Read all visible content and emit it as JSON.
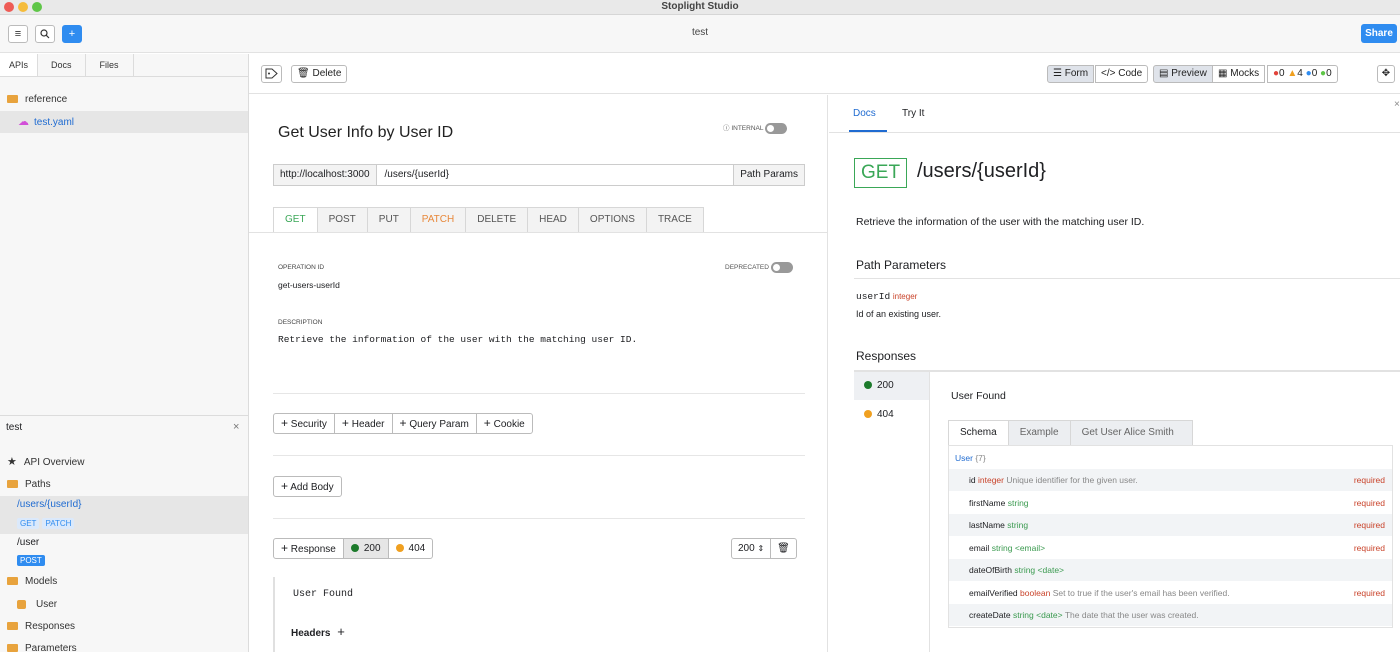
{
  "app": {
    "title": "Stoplight Studio",
    "doc_name": "test",
    "share_label": "Share"
  },
  "colors": {
    "accent": "#2f8cf0",
    "get": "#3aa757",
    "patch": "#e8883a",
    "post": "#2f8cf0",
    "required": "#c9432a",
    "integer": "#c9432a",
    "string": "#3a9a4f",
    "folder": "#e8a33d"
  },
  "topbar": {
    "menu_icon": "menu-icon",
    "search_icon": "search-icon",
    "add_label": "+"
  },
  "sidebar": {
    "tabs": [
      "APIs",
      "Docs",
      "Files"
    ],
    "tree": {
      "folder": "reference",
      "file": "test.yaml"
    },
    "project": {
      "title": "test",
      "close": "×",
      "api_overview": "API Overview",
      "paths": "Paths",
      "path1": "/users/{userId}",
      "path1_methods": [
        "GET",
        "PATCH"
      ],
      "path2": "/user",
      "path2_methods": [
        "POST"
      ],
      "models": "Models",
      "model1": "User",
      "responses": "Responses",
      "parameters": "Parameters"
    }
  },
  "toolbar": {
    "tag_icon": "tag-icon",
    "delete": "Delete",
    "form": "Form",
    "code": "Code",
    "preview": "Preview",
    "mocks": "Mocks",
    "errors": "0",
    "warnings": "4",
    "info": "0",
    "hints": "0"
  },
  "editor": {
    "title": "Get User Info by User ID",
    "internal_label": "INTERNAL",
    "server": "http://localhost:3000",
    "path": "/users/{userId}",
    "path_params_btn": "Path Params",
    "methods": [
      "GET",
      "POST",
      "PUT",
      "PATCH",
      "DELETE",
      "HEAD",
      "OPTIONS",
      "TRACE"
    ],
    "operation_id_label": "OPERATION ID",
    "operation_id": "get-users-userId",
    "deprecated_label": "DEPRECATED",
    "description_label": "DESCRIPTION",
    "description": "Retrieve the information of the user with the matching user ID.",
    "param_buttons": [
      "Security",
      "Header",
      "Query Param",
      "Cookie"
    ],
    "add_body": "Add Body",
    "response_btn": "Response",
    "responses": [
      "200",
      "404"
    ],
    "status_select": "200",
    "response_desc": "User Found",
    "headers_label": "Headers"
  },
  "preview": {
    "tabs": [
      "Docs",
      "Try It"
    ],
    "method": "GET",
    "path": "/users/{userId}",
    "description": "Retrieve the information of the user with the matching user ID.",
    "path_params_title": "Path Parameters",
    "param_name": "userId",
    "param_type": "integer",
    "param_desc": "Id of an existing user.",
    "responses_title": "Responses",
    "codes": [
      "200",
      "404"
    ],
    "response_desc": "User Found",
    "schema_tabs": [
      "Schema",
      "Example",
      "Get User Alice Smith"
    ],
    "schema_title": "User",
    "schema_count": "{7}",
    "fields": [
      {
        "name": "id",
        "type": "integer",
        "fmt": "",
        "desc": "Unique identifier for the given user.",
        "req": "required"
      },
      {
        "name": "firstName",
        "type": "string",
        "fmt": "",
        "desc": "",
        "req": "required"
      },
      {
        "name": "lastName",
        "type": "string",
        "fmt": "",
        "desc": "",
        "req": "required"
      },
      {
        "name": "email",
        "type": "string",
        "fmt": "<email>",
        "desc": "",
        "req": "required"
      },
      {
        "name": "dateOfBirth",
        "type": "string",
        "fmt": "<date>",
        "desc": "",
        "req": ""
      },
      {
        "name": "emailVerified",
        "type": "boolean",
        "fmt": "",
        "desc": "Set to true if the user's email has been verified.",
        "req": "required"
      },
      {
        "name": "createDate",
        "type": "string",
        "fmt": "<date>",
        "desc": "The date that the user was created.",
        "req": ""
      }
    ]
  }
}
